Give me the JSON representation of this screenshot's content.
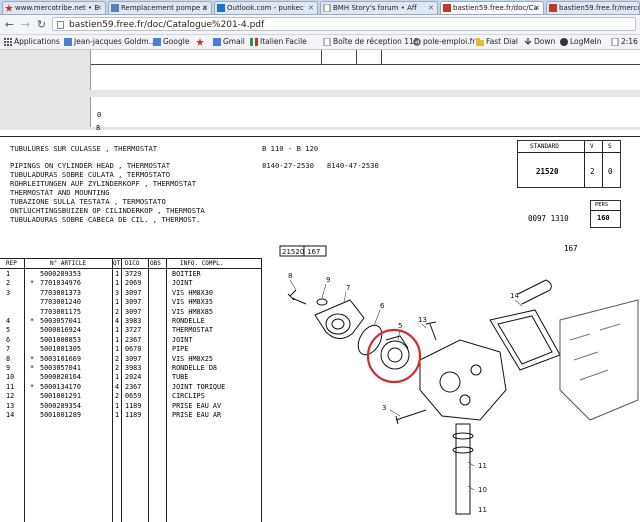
{
  "browser": {
    "tabs": [
      {
        "title": "www.mercotribe.net • E"
      },
      {
        "title": "Remplacement pompe a"
      },
      {
        "title": "Outlook.com - punkec"
      },
      {
        "title": "BMH Story's forum • Aff"
      },
      {
        "title": "bastien59.free.fr/doc/Ca"
      },
      {
        "title": "bastien59.free.fr/mercor"
      }
    ],
    "url": "bastien59.free.fr/doc/Catalogue%201-4.pdf",
    "bookmarks": [
      "Applications",
      "Jean-jacques Goldm...",
      "Google",
      "Gmail",
      "Italien Facile",
      "Boîte de réception 118",
      "pole-emploi.fr",
      "Fast Dial",
      "Down",
      "LogMeIn",
      "2:16 S"
    ]
  },
  "doc": {
    "page_marks": [
      "0",
      "8"
    ],
    "titles": [
      "TUBULURES SUR CULASSE , THERMOSTAT",
      "PIPINGS ON CYLINDER HEAD , THERMOSTAT",
      "TUBULADURAS SOBRE CULATA , TERMOSTATO",
      "ROHRLEITUNGEN AUF ZYLINDERKOPF , THERMOSTAT",
      "THERMOSTAT AND MOUNTING",
      "TUBAZIONE SULLA TESTATA , TERMOSTATO",
      "ONTLUCHTINGSBUIZEN OP CILINDERKOP , THERMOSTA",
      "TUBULADURAS SOBRE CABECA DE CIL. , THERMOST."
    ],
    "model": "B 110 - B 120",
    "refs": "8140-27-2530   8140-47-2530",
    "standard_header": [
      "STANDARD",
      "V",
      "S"
    ],
    "standard_values": [
      "21520",
      "2",
      "0"
    ],
    "pers_label": "PERS",
    "code": "0097 1310",
    "pers_value": "160",
    "page_number": "167",
    "columns": [
      "REP",
      "N° ARTICLE",
      "QT",
      "DICO",
      "OBS",
      "INFO. COMPL."
    ],
    "parts": [
      {
        "rep": "1",
        "star": "",
        "article": "5000289353",
        "qt": "1",
        "dico": "3729",
        "info": "BOITIER"
      },
      {
        "rep": "2",
        "star": "*",
        "article": "7701034976",
        "qt": "1",
        "dico": "2069",
        "info": "JOINT"
      },
      {
        "rep": "3",
        "star": "",
        "article": "7703001373",
        "qt": "3",
        "dico": "3097",
        "info": "VIS HM8X30"
      },
      {
        "rep": "",
        "star": "",
        "article": "7703001240",
        "qt": "1",
        "dico": "3097",
        "info": "VIS HM8X35"
      },
      {
        "rep": "",
        "star": "",
        "article": "7703001175",
        "qt": "2",
        "dico": "3097",
        "info": "VIS HM8X85"
      },
      {
        "rep": "4",
        "star": "*",
        "article": "5003057041",
        "qt": "4",
        "dico": "3983",
        "info": "RONDELLE"
      },
      {
        "rep": "5",
        "star": "",
        "article": "5000816924",
        "qt": "1",
        "dico": "3727",
        "info": "THERMOSTAT"
      },
      {
        "rep": "6",
        "star": "",
        "article": "5001000853",
        "qt": "1",
        "dico": "2367",
        "info": "JOINT"
      },
      {
        "rep": "7",
        "star": "",
        "article": "5001001305",
        "qt": "1",
        "dico": "0670",
        "info": "PIPE"
      },
      {
        "rep": "8",
        "star": "*",
        "article": "5003101669",
        "qt": "2",
        "dico": "3097",
        "info": "VIS HM8X25"
      },
      {
        "rep": "9",
        "star": "*",
        "article": "5003057041",
        "qt": "2",
        "dico": "3983",
        "info": "RONDELLE D8"
      },
      {
        "rep": "10",
        "star": "",
        "article": "5000820164",
        "qt": "1",
        "dico": "2024",
        "info": "TUBE"
      },
      {
        "rep": "11",
        "star": "*",
        "article": "5000134170",
        "qt": "4",
        "dico": "2367",
        "info": "JOINT TORIQUE"
      },
      {
        "rep": "12",
        "star": "",
        "article": "5001001291",
        "qt": "2",
        "dico": "0659",
        "info": "CIRCLIPS"
      },
      {
        "rep": "13",
        "star": "",
        "article": "5000289354",
        "qt": "1",
        "dico": "1189",
        "info": "PRISE EAU AV"
      },
      {
        "rep": "14",
        "star": "",
        "article": "5001001289",
        "qt": "1",
        "dico": "1189",
        "info": "PRISE EAU AR"
      }
    ],
    "diagram_ref": [
      "21520",
      "167"
    ],
    "diagram_labels": [
      "8",
      "9",
      "7",
      "6",
      "5",
      "13",
      "14",
      "3",
      "11",
      "10",
      "11"
    ],
    "highlight_color": "#d42a2a"
  }
}
